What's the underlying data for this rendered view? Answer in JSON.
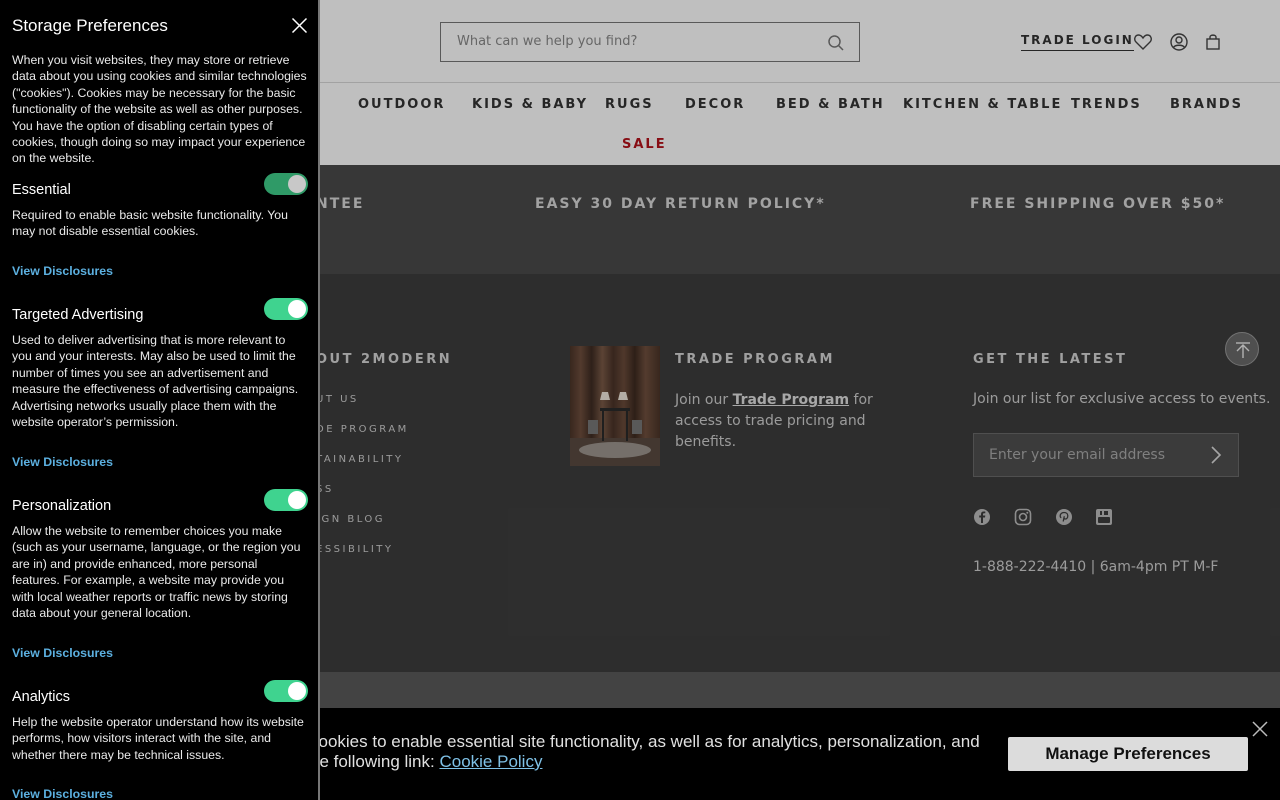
{
  "header": {
    "search_placeholder": "What can we help you find?",
    "trade_login": "TRADE LOGIN"
  },
  "nav": {
    "items": [
      "OUTDOOR",
      "KIDS & BABY",
      "RUGS",
      "DECOR",
      "BED & BATH",
      "KITCHEN & TABLE",
      "TRENDS",
      "BRANDS"
    ],
    "sale": "SALE"
  },
  "promo": {
    "items": [
      "NTEE",
      "EASY 30 DAY RETURN POLICY*",
      "FREE SHIPPING OVER $50*"
    ]
  },
  "footer": {
    "about_heading": "OUT 2MODERN",
    "about_links": [
      "UT US",
      "DE PROGRAM",
      "TAINABILITY",
      "SS",
      "IGN BLOG",
      "ESSIBILITY"
    ],
    "trade_heading": "TRADE PROGRAM",
    "trade_text_before": "Join our ",
    "trade_link": "Trade Program",
    "trade_text_after": " for access to trade pricing and benefits.",
    "latest_heading": "GET THE LATEST",
    "latest_text": "Join our list for exclusive access to events.",
    "email_placeholder": "Enter your email address",
    "phone": "1-888-222-4410 | 6am-4pm PT M-F"
  },
  "banner": {
    "line1": "cookies to enable essential site functionality, as well as for analytics, personalization, and",
    "line2_prefix": "he following link: ",
    "link": "Cookie Policy",
    "manage_button": "Manage Preferences"
  },
  "preferences": {
    "title": "Storage Preferences",
    "intro": "When you visit websites, they may store or retrieve data about you using cookies and similar technologies (\"cookies\"). Cookies may be necessary for the basic functionality of the website as well as other purposes. You have the option of disabling certain types of cookies, though doing so may impact your experience on the website.",
    "sections": [
      {
        "title": "Essential",
        "enabled": true,
        "locked": true,
        "description": "Required to enable basic website functionality. You may not disable essential cookies.",
        "link": "View Disclosures"
      },
      {
        "title": "Targeted Advertising",
        "enabled": true,
        "locked": false,
        "description": "Used to deliver advertising that is more relevant to you and your interests. May also be used to limit the number of times you see an advertisement and measure the effectiveness of advertising campaigns. Advertising networks usually place them with the website operator’s permission.",
        "link": "View Disclosures"
      },
      {
        "title": "Personalization",
        "enabled": true,
        "locked": false,
        "description": "Allow the website to remember choices you make (such as your username, language, or the region you are in) and provide enhanced, more personal features. For example, a website may provide you with local weather reports or traffic news by storing data about your general location.",
        "link": "View Disclosures"
      },
      {
        "title": "Analytics",
        "enabled": true,
        "locked": false,
        "description": "Help the website operator understand how its website performs, how visitors interact with the site, and whether there may be technical issues.",
        "link": "View Disclosures"
      }
    ]
  },
  "colors": {
    "toggle_on": "#3fd38f",
    "link_blue": "#5cb0e0",
    "sale_red": "#b5121b"
  }
}
